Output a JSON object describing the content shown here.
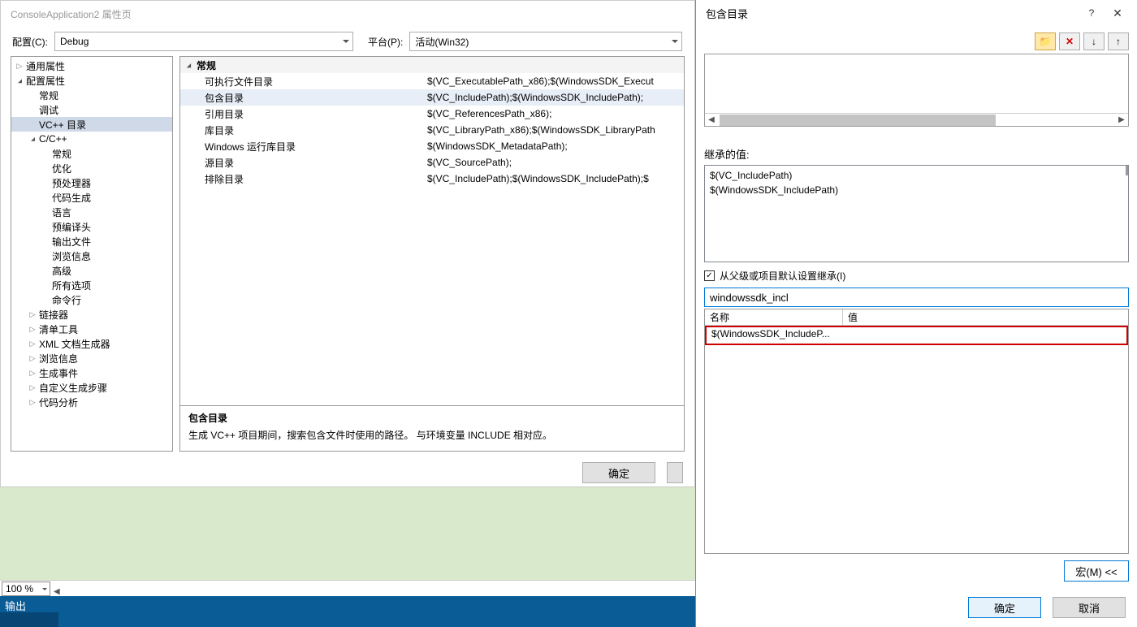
{
  "main_dialog": {
    "title": "ConsoleApplication2 属性页",
    "config_label": "配置(C):",
    "config_value": "Debug",
    "platform_label": "平台(P):",
    "platform_value": "活动(Win32)",
    "tree": {
      "common_props": "通用属性",
      "config_props": "配置属性",
      "general": "常规",
      "debug": "调试",
      "vcpp_dirs": "VC++ 目录",
      "cc": "C/C++",
      "cc_general": "常规",
      "cc_opt": "优化",
      "cc_preproc": "预处理器",
      "cc_codegen": "代码生成",
      "cc_lang": "语言",
      "cc_pch": "预编译头",
      "cc_output": "输出文件",
      "cc_browse": "浏览信息",
      "cc_adv": "高级",
      "cc_allopts": "所有选项",
      "cc_cmdline": "命令行",
      "linker": "链接器",
      "manifest": "清单工具",
      "xmldoc": "XML 文档生成器",
      "browseinfo": "浏览信息",
      "buildevents": "生成事件",
      "custombuild": "自定义生成步骤",
      "codeanalysis": "代码分析"
    },
    "props": {
      "group": "常规",
      "rows": [
        {
          "name": "可执行文件目录",
          "value": "$(VC_ExecutablePath_x86);$(WindowsSDK_Execut"
        },
        {
          "name": "包含目录",
          "value": "$(VC_IncludePath);$(WindowsSDK_IncludePath);"
        },
        {
          "name": "引用目录",
          "value": "$(VC_ReferencesPath_x86);"
        },
        {
          "name": "库目录",
          "value": "$(VC_LibraryPath_x86);$(WindowsSDK_LibraryPath"
        },
        {
          "name": "Windows 运行库目录",
          "value": "$(WindowsSDK_MetadataPath);"
        },
        {
          "name": "源目录",
          "value": "$(VC_SourcePath);"
        },
        {
          "name": "排除目录",
          "value": "$(VC_IncludePath);$(WindowsSDK_IncludePath);$"
        }
      ]
    },
    "desc": {
      "title": "包含目录",
      "text": "生成 VC++ 项目期间，搜索包含文件时使用的路径。   与环境变量 INCLUDE 相对应。"
    },
    "buttons": {
      "ok": "确定"
    }
  },
  "bottom": {
    "zoom": "100 %",
    "output": "输出"
  },
  "popup": {
    "title": "包含目录",
    "help": "?",
    "inherited_label": "继承的值:",
    "inherited_values": [
      "$(VC_IncludePath)",
      "$(WindowsSDK_IncludePath)"
    ],
    "inherit_checkbox": "从父级或项目默认设置继承(I)",
    "inherit_checked": "✓",
    "search_value": "windowssdk_incl",
    "results_header": {
      "name": "名称",
      "value": "值"
    },
    "results_row": {
      "name": "$(WindowsSDK_IncludeP...",
      "value": ""
    },
    "macros_btn": "宏(M) <<",
    "ok": "确定",
    "cancel": "取消"
  }
}
